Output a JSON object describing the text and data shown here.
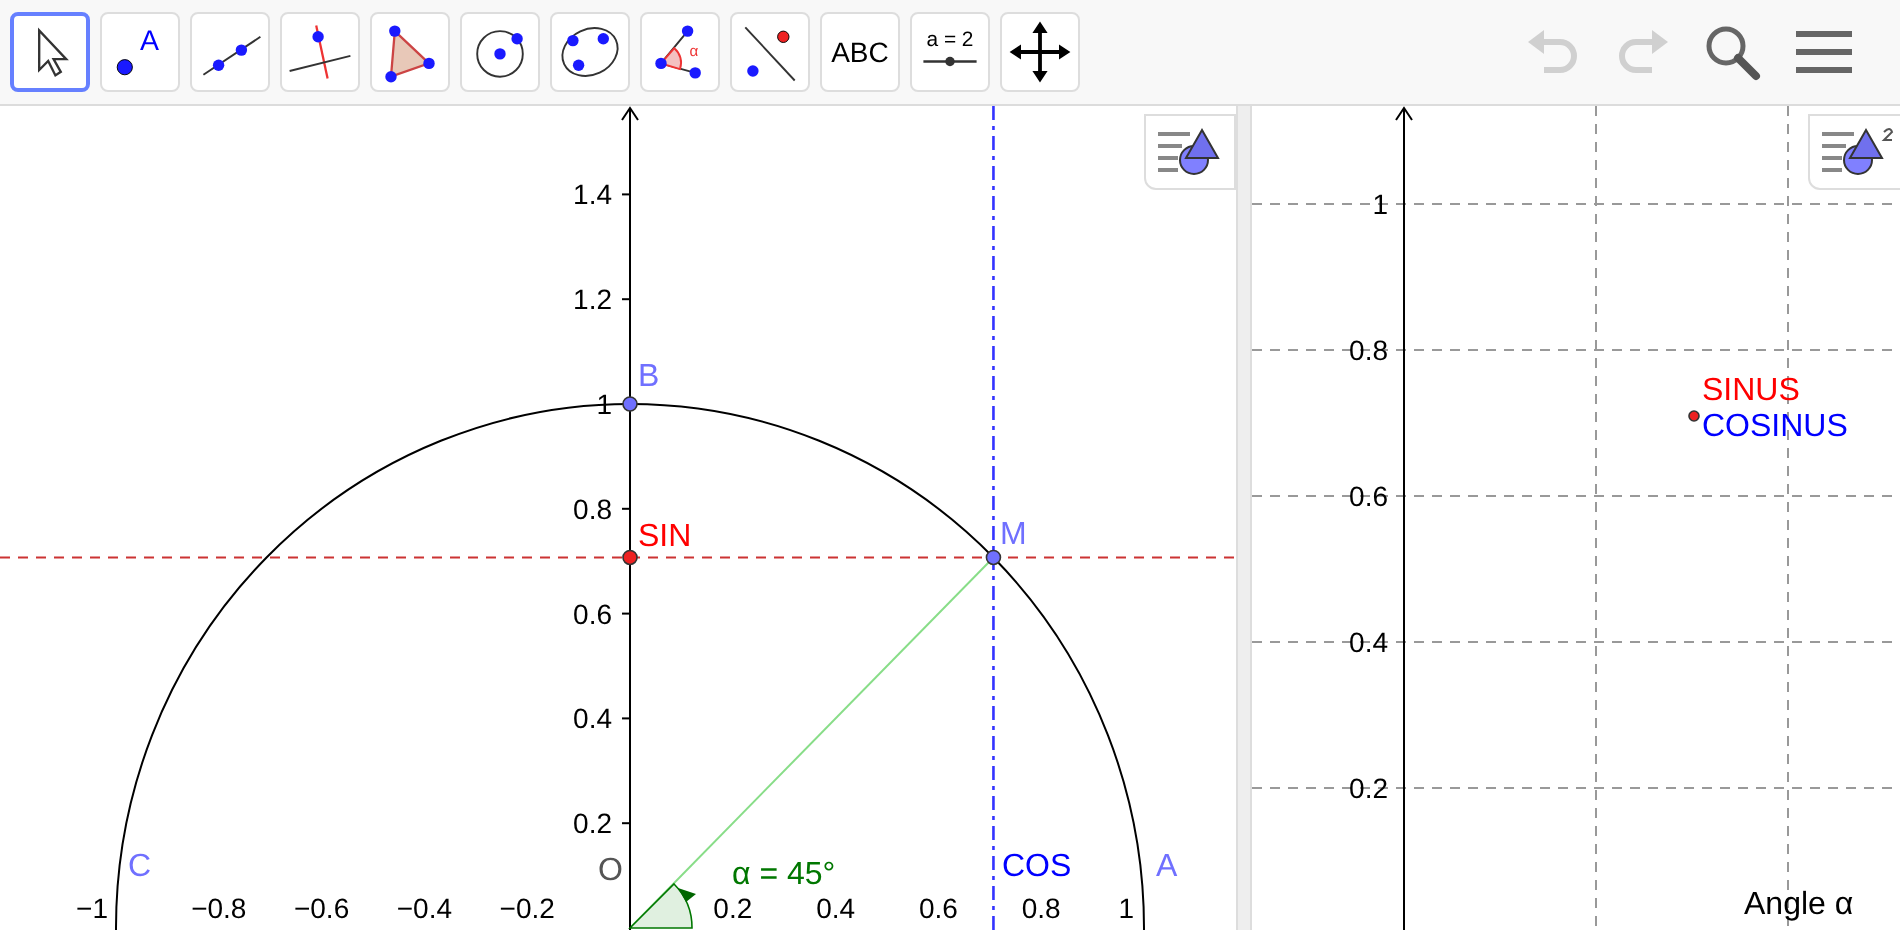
{
  "toolbar": {
    "tools": [
      {
        "kind": "move",
        "selected": true
      },
      {
        "kind": "point",
        "label": "A",
        "selected": false
      },
      {
        "kind": "line",
        "selected": false
      },
      {
        "kind": "perpendicular",
        "selected": false
      },
      {
        "kind": "polygon",
        "selected": false
      },
      {
        "kind": "circle",
        "selected": false
      },
      {
        "kind": "conic",
        "selected": false
      },
      {
        "kind": "angle",
        "label": "α",
        "selected": false
      },
      {
        "kind": "reflect",
        "selected": false
      },
      {
        "kind": "text",
        "label": "ABC",
        "selected": false
      },
      {
        "kind": "slider",
        "label": "a = 2",
        "selected": false
      },
      {
        "kind": "pan",
        "selected": false
      }
    ],
    "undo": {
      "disabled": true
    },
    "redo": {
      "disabled": true
    }
  },
  "graphics_1": {
    "y_ticks": [
      "1.4",
      "1.2",
      "1",
      "0.8",
      "0.6",
      "0.4",
      "0.2"
    ],
    "x_ticks": [
      "−1",
      "−0.8",
      "−0.6",
      "−0.4",
      "−0.2",
      "0.2",
      "0.4",
      "0.6",
      "0.8",
      "1"
    ],
    "labels": [
      {
        "text": "B",
        "color": "#7070ff"
      },
      {
        "text": "SIN",
        "color": "#ff0000"
      },
      {
        "text": "M",
        "color": "#7070ff"
      },
      {
        "text": "C",
        "color": "#7070ff"
      },
      {
        "text": "O",
        "color": "#555555"
      },
      {
        "text": "α = 45°",
        "color": "#007700"
      },
      {
        "text": "COS",
        "color": "#0000ff"
      },
      {
        "text": "A",
        "color": "#7070ff"
      }
    ]
  },
  "graphics_2": {
    "y_ticks": [
      "1",
      "0.8",
      "0.6",
      "0.4",
      "0.2"
    ],
    "labels": [
      {
        "text": "SINUS",
        "color": "#ff0000"
      },
      {
        "text": "COSINUS",
        "color": "#0000ff"
      }
    ],
    "x_axis_label": "Angle α"
  }
}
